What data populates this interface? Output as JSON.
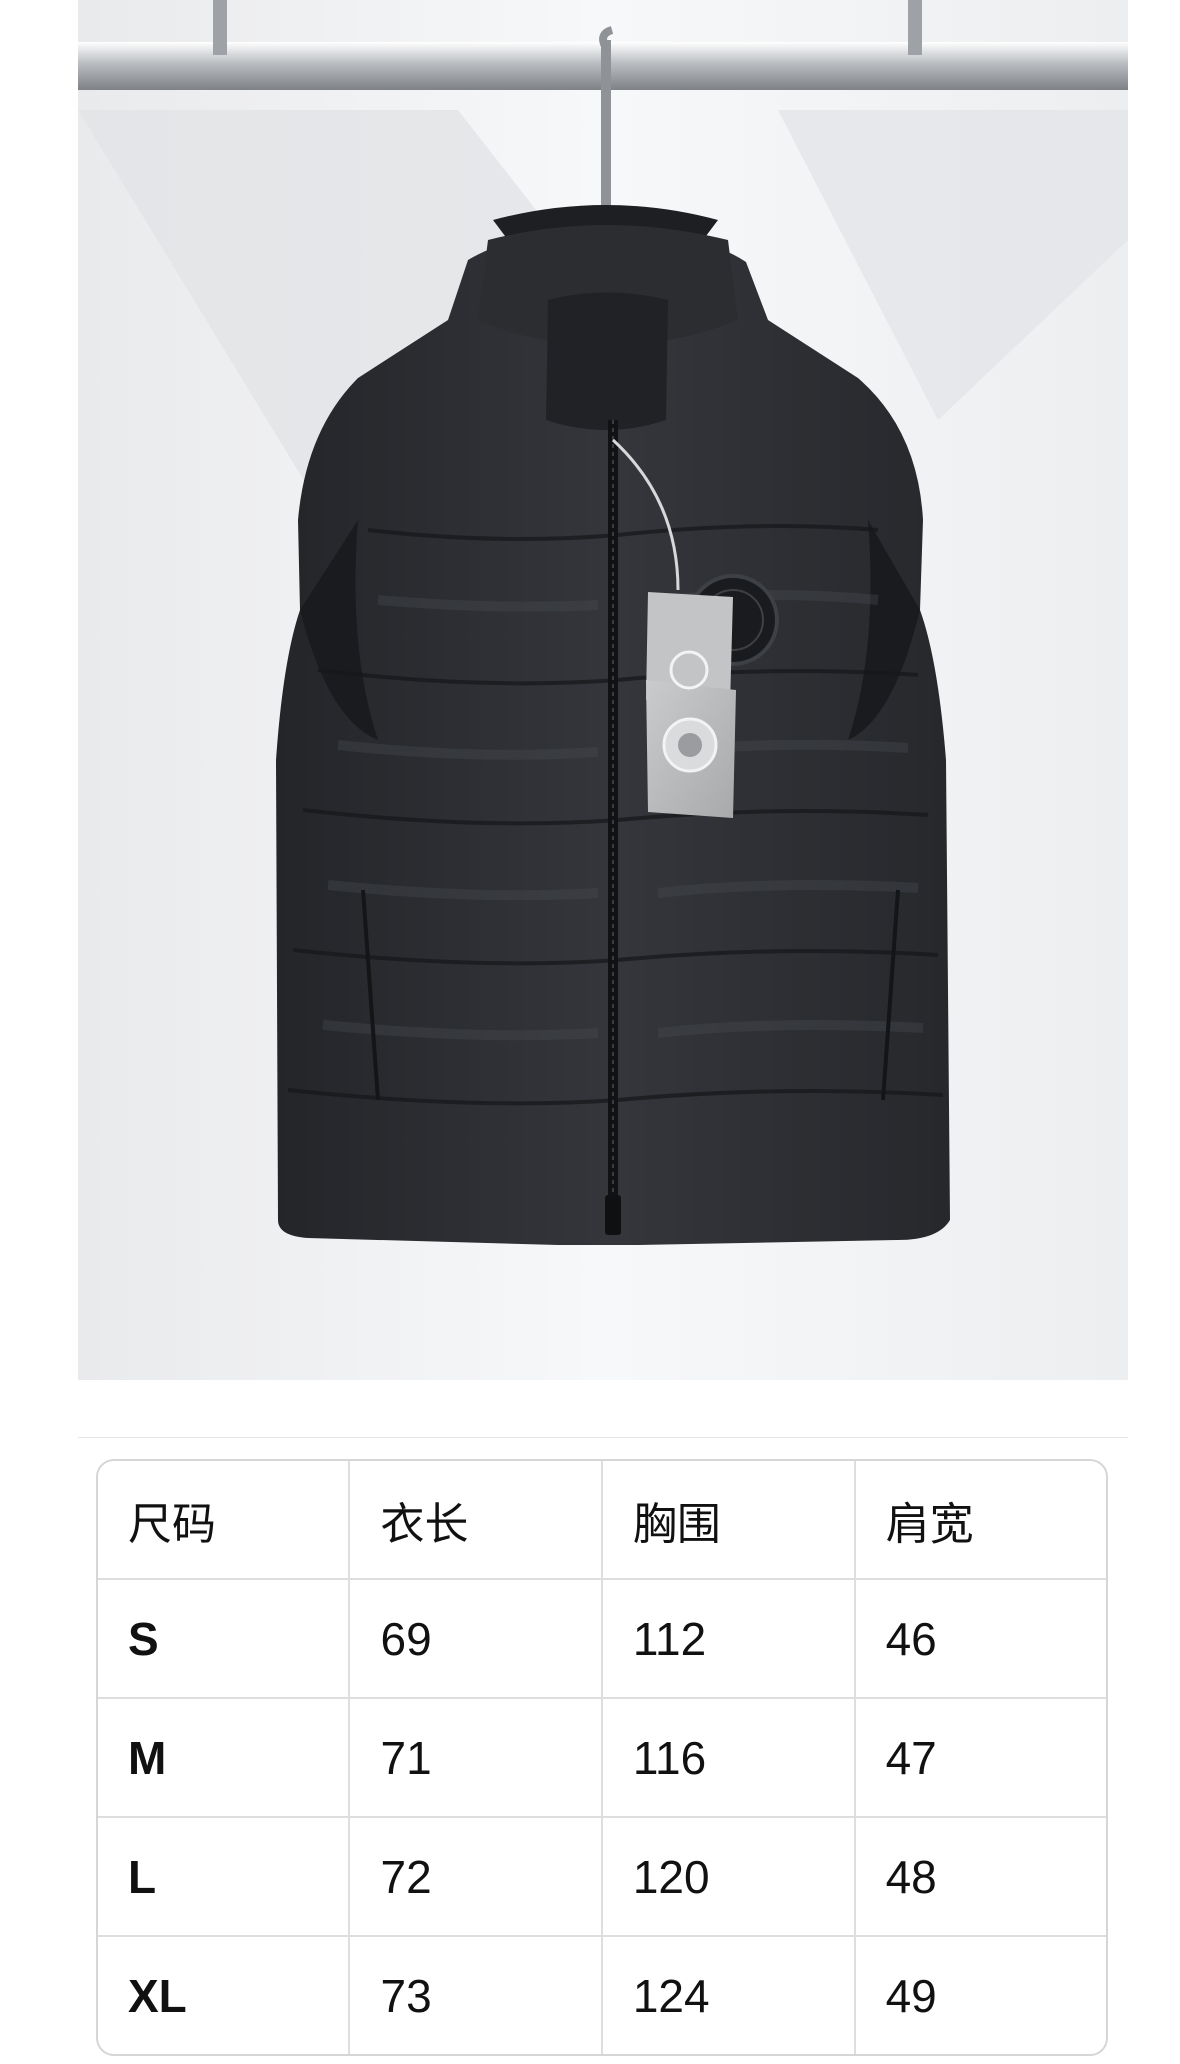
{
  "size_chart": {
    "headers": [
      "尺码",
      "衣长",
      "胸围",
      "肩宽"
    ],
    "rows": [
      [
        "S",
        "69",
        "112",
        "46"
      ],
      [
        "M",
        "71",
        "116",
        "47"
      ],
      [
        "L",
        "72",
        "120",
        "48"
      ],
      [
        "XL",
        "73",
        "124",
        "49"
      ]
    ]
  },
  "colors": {
    "vest": "#2a2c30",
    "background": "#f3f4f6",
    "hang_tag": "#b9bbbd"
  }
}
